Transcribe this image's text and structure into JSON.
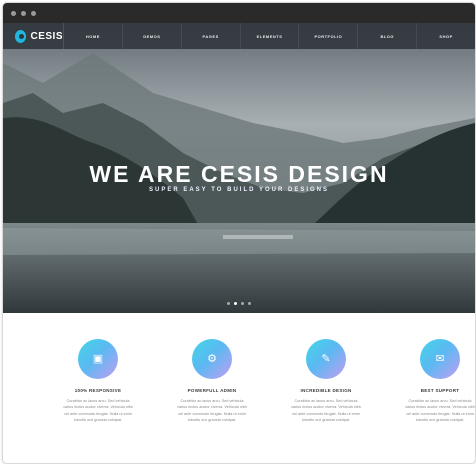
{
  "brand": {
    "name": "CESIS",
    "accent": "#1fb6e0"
  },
  "nav": {
    "items": [
      "HOME",
      "DEMOS",
      "PAGES",
      "ELEMENTS",
      "PORTFOLIO",
      "BLOG",
      "SHOP"
    ]
  },
  "hero": {
    "title": "WE ARE CESIS DESIGN",
    "subtitle": "SUPER EASY TO BUILD YOUR DESIGNS",
    "slides": {
      "count": 4,
      "active": 2
    }
  },
  "features": [
    {
      "icon": "monitor-icon",
      "title": "100% RESPONSIVE",
      "text": "Curabitur ac lacus arcu. Sed vehicula varius lectus auctor viverra. Vehicula nibh vel ante commodo feugiat. Nulla ut enim lobortis orci gravida volutpat."
    },
    {
      "icon": "gear-icon",
      "title": "POWERFULL ADMIN",
      "text": "Curabitur ac lacus arcu. Sed vehicula varius lectus auctor viverra. Vehicula nibh vel ante commodo feugiat. Nulla ut enim lobortis orci gravida volutpat."
    },
    {
      "icon": "design-icon",
      "title": "INCREDIBLE DESIGN",
      "text": "Curabitur ac lacus arcu. Sed vehicula varius lectus auctor viverra. Vehicula nibh vel ante commodo feugiat. Nulla ut enim lobortis orci gravida volutpat."
    },
    {
      "icon": "chat-icon",
      "title": "BEST SUPPORT",
      "text": "Curabitur ac lacus arcu. Sed vehicula varius lectus auctor viverra. Vehicula nibh vel ante commodo feugiat. Nulla ut enim lobortis orci gravida volutpat."
    }
  ]
}
